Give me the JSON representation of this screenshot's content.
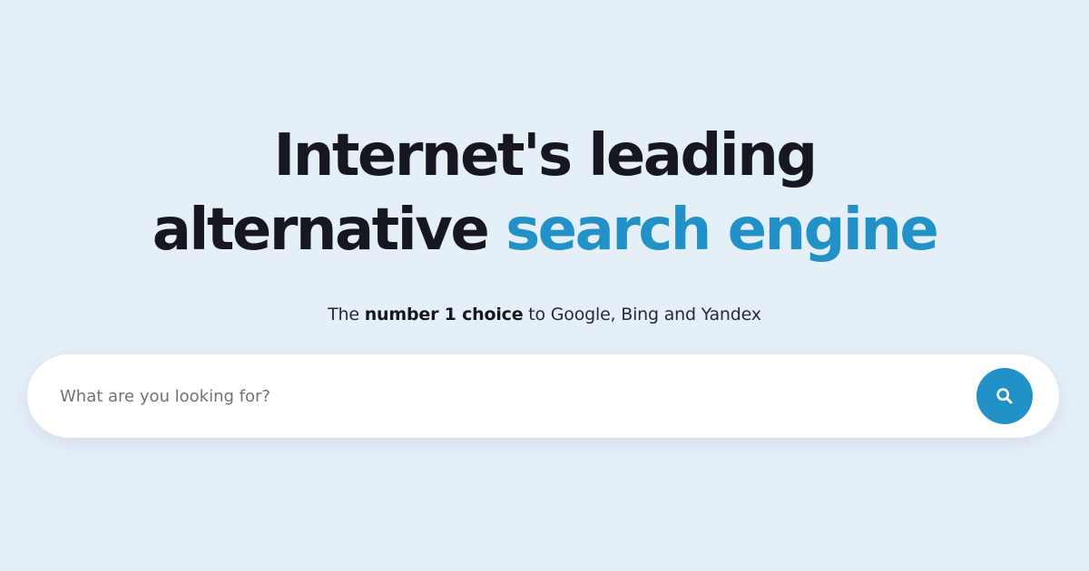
{
  "hero": {
    "headline_line1": "Internet's leading",
    "headline_line2_plain": "alternative ",
    "headline_line2_accent": "search engine",
    "subtitle_prefix": "The ",
    "subtitle_strong": "number 1 choice",
    "subtitle_suffix": " to Google, Bing and Yandex"
  },
  "search": {
    "placeholder": "What are you looking for?",
    "value": "",
    "button_icon": "search-icon"
  },
  "colors": {
    "background": "#e5eff8",
    "accent": "#2191c8",
    "headline": "#17171f",
    "search_bar": "#ffffff"
  }
}
